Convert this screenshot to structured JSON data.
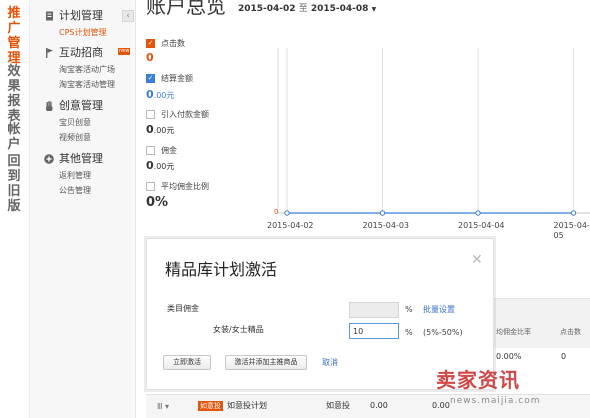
{
  "nav_vertical": [
    {
      "label": "推广管理",
      "active": true
    },
    {
      "label": "效果报表",
      "active": false
    },
    {
      "label": "帐户",
      "active": false
    },
    {
      "label": "回到旧版",
      "active": false
    }
  ],
  "sidebar": {
    "collapse_icon": "chevron-left-icon",
    "groups": [
      {
        "title": "计划管理",
        "icon": "doc-icon",
        "items": [
          {
            "label": "CPS计划管理",
            "active": true
          }
        ]
      },
      {
        "title": "互动招商",
        "icon": "flag-icon",
        "badge": "new",
        "items": [
          {
            "label": "淘宝客活动广场"
          },
          {
            "label": "淘宝客活动管理"
          }
        ]
      },
      {
        "title": "创意管理",
        "icon": "hand-icon",
        "items": [
          {
            "label": "宝贝创意"
          },
          {
            "label": "视频创意"
          }
        ]
      },
      {
        "title": "其他管理",
        "icon": "plus-circle-icon",
        "items": [
          {
            "label": "返利管理"
          },
          {
            "label": "公告管理"
          }
        ]
      }
    ]
  },
  "header": {
    "title": "账户总览",
    "date_start": "2015-04-02",
    "date_sep": "至",
    "date_end": "2015-04-08"
  },
  "metrics": [
    {
      "label": "点击数",
      "value": "0",
      "unit": "",
      "checked": true
    },
    {
      "label": "结算金额",
      "value": "0",
      "unit": ".00元",
      "checked": true
    },
    {
      "label": "引入付款金额",
      "value": "0",
      "unit": ".00元",
      "checked": false
    },
    {
      "label": "佣金",
      "value": "0",
      "unit": ".00元",
      "checked": false
    },
    {
      "label": "平均佣金比例",
      "value": "0%",
      "unit": "",
      "checked": false
    }
  ],
  "chart_data": {
    "type": "line",
    "categories": [
      "2015-04-02",
      "2015-04-03",
      "2015-04-04",
      "2015-04-05"
    ],
    "series": [
      {
        "values": [
          0,
          0,
          0,
          0
        ],
        "color": "#3a7ed8"
      }
    ],
    "yticks": [
      "0"
    ],
    "grid": true
  },
  "table_bg": {
    "headers": [
      "均佣金比率",
      "点击数"
    ],
    "row1": [
      "0.00%",
      "0"
    ],
    "bottom": {
      "tag": "如意投",
      "plan": "如意投计划",
      "type": "如意投",
      "v1": "0.00",
      "v2": "0.00"
    }
  },
  "modal": {
    "title": "精品库计划激活",
    "field1_label": "类目佣金",
    "field1_value": "",
    "pct": "%",
    "batch_link": "批量设置",
    "field2_label": "女装/女士精品",
    "field2_value": "10",
    "range_hint": "(5%-50%)",
    "btn_activate": "立即激活",
    "btn_activate_add": "激活并添加主推商品",
    "cancel": "取消",
    "close_icon": "close-icon"
  },
  "watermark": {
    "text": "卖家资讯",
    "url": "news.maijia.com"
  }
}
